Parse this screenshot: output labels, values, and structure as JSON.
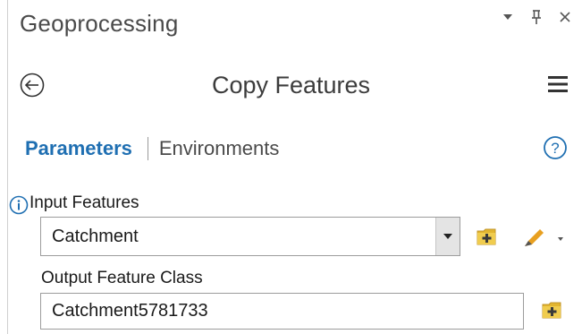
{
  "pane": {
    "title": "Geoprocessing",
    "controls": [
      {
        "name": "dropdown-arrow-icon"
      },
      {
        "name": "pin-icon"
      },
      {
        "name": "close-icon"
      }
    ]
  },
  "tool": {
    "title": "Copy Features"
  },
  "tabs": [
    {
      "label": "Parameters",
      "active": true
    },
    {
      "label": "Environments",
      "active": false
    }
  ],
  "params": {
    "input_features": {
      "label": "Input Features",
      "value": "Catchment"
    },
    "output_feature_class": {
      "label": "Output Feature Class",
      "value": "Catchment5781733"
    }
  },
  "colors": {
    "accent": "#1f6fb2",
    "folder_icon": "#e2b52f",
    "pencil_icon": "#e8a020"
  }
}
